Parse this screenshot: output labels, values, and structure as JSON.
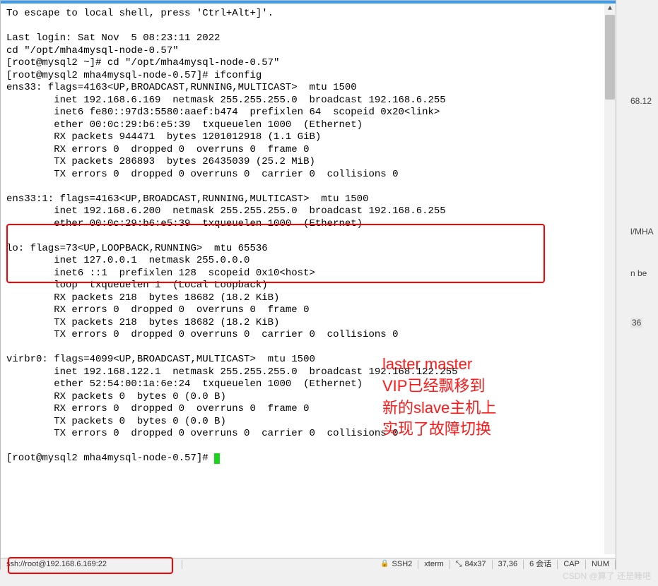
{
  "terminal": {
    "line01": "To escape to local shell, press 'Ctrl+Alt+]'.",
    "line02": "",
    "line03": "Last login: Sat Nov  5 08:23:11 2022",
    "line04": "cd \"/opt/mha4mysql-node-0.57\"",
    "line05": "[root@mysql2 ~]# cd \"/opt/mha4mysql-node-0.57\"",
    "line06": "[root@mysql2 mha4mysql-node-0.57]# ifconfig",
    "line07": "ens33: flags=4163<UP,BROADCAST,RUNNING,MULTICAST>  mtu 1500",
    "line08": "        inet 192.168.6.169  netmask 255.255.255.0  broadcast 192.168.6.255",
    "line09": "        inet6 fe80::97d3:5580:aaef:b474  prefixlen 64  scopeid 0x20<link>",
    "line10": "        ether 00:0c:29:b6:e5:39  txqueuelen 1000  (Ethernet)",
    "line11": "        RX packets 944471  bytes 1201012918 (1.1 GiB)",
    "line12": "        RX errors 0  dropped 0  overruns 0  frame 0",
    "line13": "        TX packets 286893  bytes 26435039 (25.2 MiB)",
    "line14": "        TX errors 0  dropped 0 overruns 0  carrier 0  collisions 0",
    "line15": "",
    "line16": "ens33:1: flags=4163<UP,BROADCAST,RUNNING,MULTICAST>  mtu 1500",
    "line17": "        inet 192.168.6.200  netmask 255.255.255.0  broadcast 192.168.6.255",
    "line18": "        ether 00:0c:29:b6:e5:39  txqueuelen 1000  (Ethernet)",
    "line19": "",
    "line20": "lo: flags=73<UP,LOOPBACK,RUNNING>  mtu 65536",
    "line21": "        inet 127.0.0.1  netmask 255.0.0.0",
    "line22": "        inet6 ::1  prefixlen 128  scopeid 0x10<host>",
    "line23": "        loop  txqueuelen 1  (Local Loopback)",
    "line24": "        RX packets 218  bytes 18682 (18.2 KiB)",
    "line25": "        RX errors 0  dropped 0  overruns 0  frame 0",
    "line26": "        TX packets 218  bytes 18682 (18.2 KiB)",
    "line27": "        TX errors 0  dropped 0 overruns 0  carrier 0  collisions 0",
    "line28": "",
    "line29": "virbr0: flags=4099<UP,BROADCAST,MULTICAST>  mtu 1500",
    "line30": "        inet 192.168.122.1  netmask 255.255.255.0  broadcast 192.168.122.255",
    "line31": "        ether 52:54:00:1a:6e:24  txqueuelen 1000  (Ethernet)",
    "line32": "        RX packets 0  bytes 0 (0.0 B)",
    "line33": "        RX errors 0  dropped 0  overruns 0  frame 0",
    "line34": "        TX packets 0  bytes 0 (0.0 B)",
    "line35": "        TX errors 0  dropped 0 overruns 0  carrier 0  collisions 0",
    "line36": "",
    "prompt": "[root@mysql2 mha4mysql-node-0.57]# "
  },
  "annotation": "laster master\nVIP已经飘移到\n新的slave主机上\n实现了故障切换",
  "status": {
    "conn": "ssh://root@192.168.6.169:22",
    "proto": "SSH2",
    "term": "xterm",
    "size": "84x37",
    "pos": "37,36",
    "sess": "6 会话",
    "cap": "CAP",
    "num": "NUM"
  },
  "bg": {
    "ip": "68.12",
    "mha": "l/MHA",
    "be": "n be",
    "num": "36"
  },
  "watermark": "CSDN @算了 还是睡吧"
}
